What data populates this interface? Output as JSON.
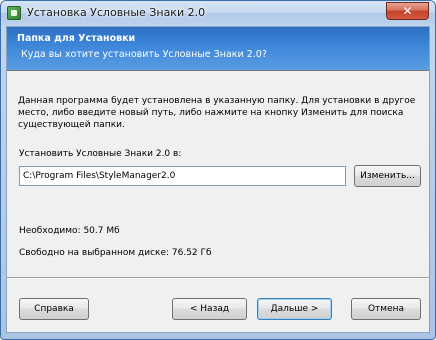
{
  "window": {
    "title": "Установка Условные Знаки 2.0",
    "close_symbol": "✕"
  },
  "header": {
    "title": "Папка для Установки",
    "subtitle": "Куда вы хотите установить Условные Знаки  2.0?"
  },
  "body": {
    "description": "Данная программа будет установлена в указанную папку. Для установки в другое место, либо введите новый путь, либо нажмите на кнопку Изменить для поиска существующей папки.",
    "path_label": "Установить Условные Знаки 2.0 в:",
    "path_value": "C:\\Program Files\\StyleManager2.0",
    "change_button_label": "Изменить...",
    "required_space": "Необходимо: 50.7 Мб",
    "free_space": "Свободно на выбранном диске: 76.52 Гб"
  },
  "footer": {
    "help_label": "Справка",
    "back_label": "< Назад",
    "next_label": "Дальше >",
    "cancel_label": "Отмена"
  },
  "icons": {
    "app": "app-icon",
    "close": "close-icon"
  },
  "colors": {
    "header_gradient_top": "#2d6ec2",
    "header_gradient_bottom": "#5a9ce2",
    "close_button": "#c2452b"
  }
}
